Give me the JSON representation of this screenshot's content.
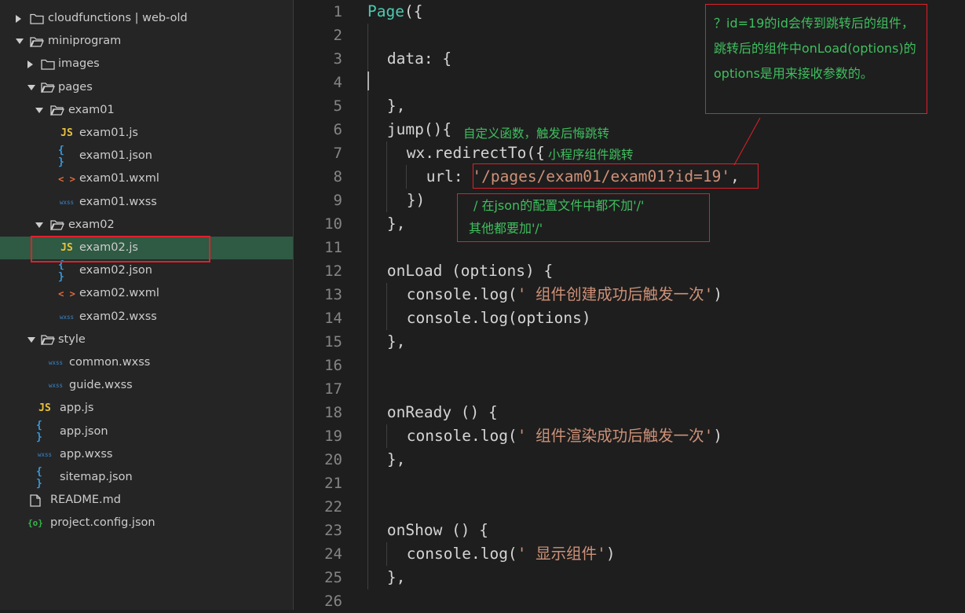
{
  "sidebar": {
    "items": [
      {
        "label": "cloudfunctions | web-old",
        "icon": "folder-icon",
        "kind": "folder",
        "expanded": false
      },
      {
        "label": "miniprogram",
        "icon": "folder-open-icon",
        "kind": "folder",
        "expanded": true
      },
      {
        "label": "images",
        "icon": "folder-icon",
        "kind": "folder",
        "expanded": false
      },
      {
        "label": "pages",
        "icon": "folder-open-icon",
        "kind": "folder",
        "expanded": true
      },
      {
        "label": "exam01",
        "icon": "folder-open-icon",
        "kind": "folder",
        "expanded": true
      },
      {
        "label": "exam01.js",
        "icon": "js-file-icon",
        "icon_text": "JS",
        "kind": "js"
      },
      {
        "label": "exam01.json",
        "icon": "json-file-icon",
        "icon_text": "{ }",
        "kind": "json"
      },
      {
        "label": "exam01.wxml",
        "icon": "wxml-file-icon",
        "icon_text": "< >",
        "kind": "wxml"
      },
      {
        "label": "exam01.wxss",
        "icon": "wxss-file-icon",
        "icon_text": "wxss",
        "kind": "wxss"
      },
      {
        "label": "exam02",
        "icon": "folder-open-icon",
        "kind": "folder",
        "expanded": true
      },
      {
        "label": "exam02.js",
        "icon": "js-file-icon",
        "icon_text": "JS",
        "kind": "js",
        "selected": true
      },
      {
        "label": "exam02.json",
        "icon": "json-file-icon",
        "icon_text": "{ }",
        "kind": "json"
      },
      {
        "label": "exam02.wxml",
        "icon": "wxml-file-icon",
        "icon_text": "< >",
        "kind": "wxml"
      },
      {
        "label": "exam02.wxss",
        "icon": "wxss-file-icon",
        "icon_text": "wxss",
        "kind": "wxss"
      },
      {
        "label": "style",
        "icon": "folder-open-icon",
        "kind": "folder",
        "expanded": true
      },
      {
        "label": "common.wxss",
        "icon": "wxss-file-icon",
        "icon_text": "wxss",
        "kind": "wxss"
      },
      {
        "label": "guide.wxss",
        "icon": "wxss-file-icon",
        "icon_text": "wxss",
        "kind": "wxss"
      },
      {
        "label": "app.js",
        "icon": "js-file-icon",
        "icon_text": "JS",
        "kind": "js"
      },
      {
        "label": "app.json",
        "icon": "json-file-icon",
        "icon_text": "{ }",
        "kind": "json"
      },
      {
        "label": "app.wxss",
        "icon": "wxss-file-icon",
        "icon_text": "wxss",
        "kind": "wxss"
      },
      {
        "label": "sitemap.json",
        "icon": "json-file-icon",
        "icon_text": "{ }",
        "kind": "json"
      },
      {
        "label": "README.md",
        "icon": "file-icon",
        "kind": "file"
      },
      {
        "label": "project.config.json",
        "icon": "config-file-icon",
        "icon_text": "{o}",
        "kind": "cfg"
      }
    ]
  },
  "editor": {
    "lines": [
      {
        "n": "1",
        "code": "Page({"
      },
      {
        "n": "2",
        "code": ""
      },
      {
        "n": "3",
        "code": "data: {"
      },
      {
        "n": "4",
        "code": ""
      },
      {
        "n": "5",
        "code": "},"
      },
      {
        "n": "6",
        "code": "jump(){"
      },
      {
        "n": "7",
        "code": "wx.redirectTo({"
      },
      {
        "n": "8",
        "code_pre": "url: ",
        "code_str": "'/pages/exam01/exam01?id=19'",
        "code_post": ","
      },
      {
        "n": "9",
        "code": "})"
      },
      {
        "n": "10",
        "code": "},"
      },
      {
        "n": "11",
        "code": ""
      },
      {
        "n": "12",
        "code": "onLoad (options) {"
      },
      {
        "n": "13",
        "code_pre": "console.log(",
        "code_str": "' 组件创建成功后触发一次'",
        "code_post": ")"
      },
      {
        "n": "14",
        "code": "console.log(options)"
      },
      {
        "n": "15",
        "code": "},"
      },
      {
        "n": "16",
        "code": ""
      },
      {
        "n": "17",
        "code": ""
      },
      {
        "n": "18",
        "code": "onReady () {"
      },
      {
        "n": "19",
        "code_pre": "console.log(",
        "code_str": "' 组件渲染成功后触发一次'",
        "code_post": ")"
      },
      {
        "n": "20",
        "code": "},"
      },
      {
        "n": "21",
        "code": ""
      },
      {
        "n": "22",
        "code": ""
      },
      {
        "n": "23",
        "code": "onShow () {"
      },
      {
        "n": "24",
        "code_pre": "console.log(",
        "code_str": "' 显示组件'",
        "code_post": ")"
      },
      {
        "n": "25",
        "code": "},"
      },
      {
        "n": "26",
        "code": ""
      }
    ],
    "annotations": {
      "jump_comment": "自定义函数，触发后悔跳转",
      "redirect_comment": "小程序组件跳转",
      "note": "？id=19的id会传到跳转后的组件， 跳转后的组件中onLoad(options)的options是用来接收参数的。",
      "slash_note_line1": "/ 在json的配置文件中都不加'/'",
      "slash_note_line2": "其他都要加'/'"
    }
  },
  "colors": {
    "accent_red": "#e0202a",
    "annotation_green": "#3fbf5f",
    "string": "#ce9178",
    "identifier": "#4ec9b0",
    "selected_row": "#2f5a43"
  }
}
